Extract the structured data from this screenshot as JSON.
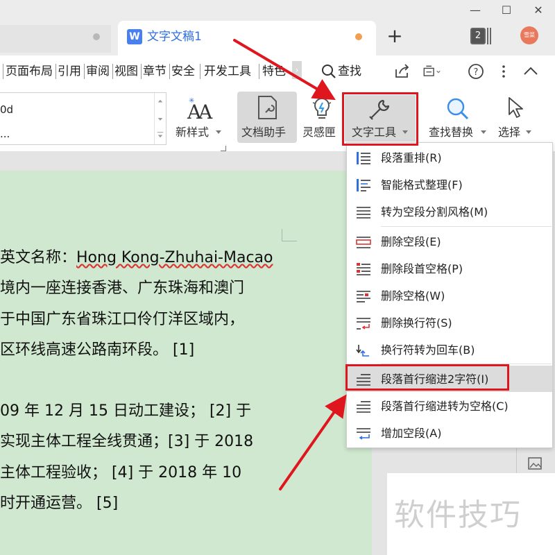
{
  "window": {
    "minimize_glyph": "—",
    "maximize_glyph": "☐",
    "close_glyph": "✕"
  },
  "tabs": {
    "active_title": "文字文稿1",
    "doc_icon_letter": "W",
    "add_glyph": "+",
    "tab_count": "2",
    "avatar_text": "雪菜"
  },
  "menu": {
    "items": [
      "页面布局",
      "引用",
      "审阅",
      "视图",
      "章节",
      "安全",
      "开发工具",
      "特色"
    ],
    "more_glyph": "›",
    "search_label": "查找"
  },
  "ribbon": {
    "style_line1": "0d",
    "style_line2": "...",
    "new_style": "新样式",
    "doc_helper": "文档助手",
    "inspiration": "灵感匣",
    "text_tools": "文字工具",
    "find_replace": "查找替换",
    "select": "选择"
  },
  "dropdown": {
    "items": [
      {
        "label": "段落重排(R)",
        "icon": "paragraph-rearrange-icon"
      },
      {
        "label": "智能格式整理(F)",
        "icon": "smart-format-icon"
      },
      {
        "label": "转为空段分割风格(M)",
        "icon": "empty-paragraph-style-icon"
      },
      {
        "label": "删除空段(E)",
        "icon": "delete-empty-paragraph-icon"
      },
      {
        "label": "删除段首空格(P)",
        "icon": "delete-leading-space-icon"
      },
      {
        "label": "删除空格(W)",
        "icon": "delete-space-icon"
      },
      {
        "label": "删除换行符(S)",
        "icon": "delete-line-break-icon"
      },
      {
        "label": "换行符转为回车(B)",
        "icon": "line-break-to-enter-icon"
      },
      {
        "label": "段落首行缩进2字符(I)",
        "icon": "first-line-indent-icon"
      },
      {
        "label": "段落首行缩进转为空格(C)",
        "icon": "indent-to-space-icon"
      },
      {
        "label": "增加空段(A)",
        "icon": "add-empty-paragraph-icon"
      }
    ],
    "highlighted_index": 8
  },
  "document": {
    "lines": [
      {
        "cn": "英文名称：",
        "en": "Hong Kong-Zhuhai-Macao"
      },
      {
        "text": "境内一座连接香港、广东珠海和澳门"
      },
      {
        "text": "于中国广东省珠江口伶仃洋区域内，"
      },
      {
        "text": "区环线高速公路南环段。 [1]"
      },
      {
        "text": "09 年 12 月 15 日动工建设；  [2]    于"
      },
      {
        "text": "实现主体工程全线贯通；[3]    于 2018"
      },
      {
        "text": "主体工程验收；    [4]    于 2018 年 10"
      },
      {
        "text": "时开通运营。  [5]"
      }
    ]
  },
  "watermark": "软件技巧",
  "colors": {
    "accent_blue": "#2f6fe0",
    "annotation_red": "#e0161f",
    "page_green": "#cfe8cf"
  }
}
